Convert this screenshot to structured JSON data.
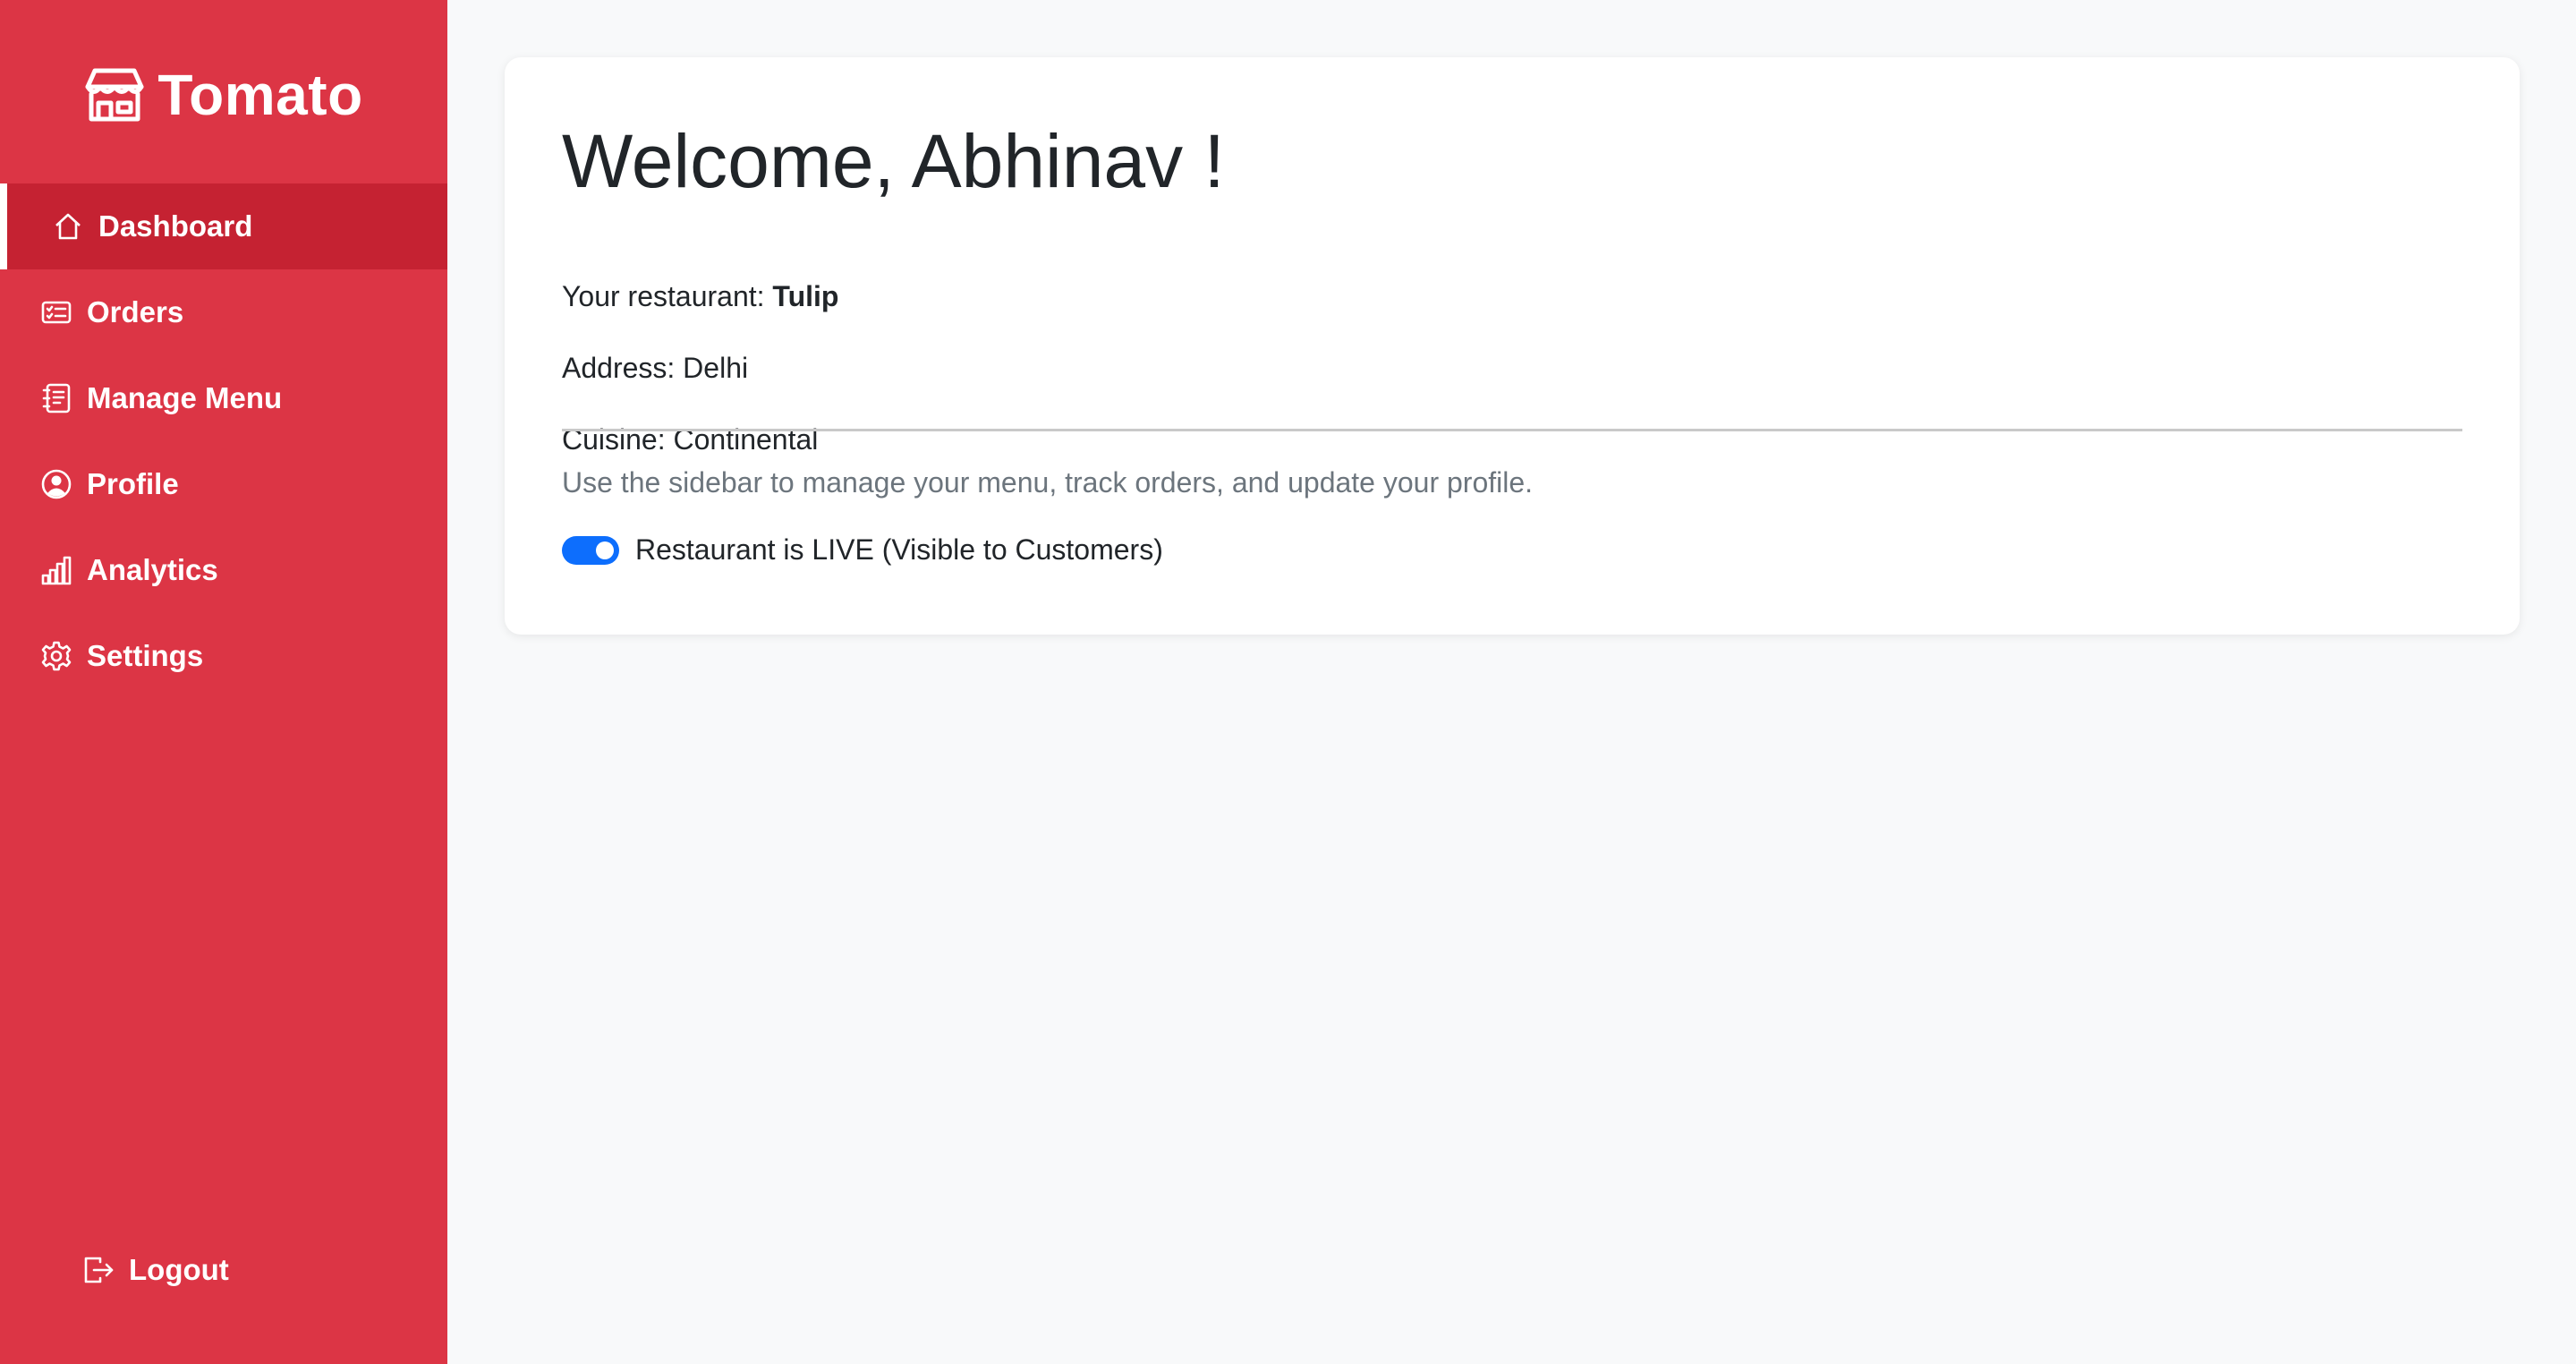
{
  "brand": {
    "name": "Tomato",
    "icon": "shop-icon"
  },
  "sidebar": {
    "items": [
      {
        "label": "Dashboard",
        "icon": "house-icon",
        "active": true
      },
      {
        "label": "Orders",
        "icon": "card-checklist-icon",
        "active": false
      },
      {
        "label": "Manage Menu",
        "icon": "journal-text-icon",
        "active": false
      },
      {
        "label": "Profile",
        "icon": "person-circle-icon",
        "active": false
      },
      {
        "label": "Analytics",
        "icon": "bar-chart-icon",
        "active": false
      },
      {
        "label": "Settings",
        "icon": "gear-icon",
        "active": false
      }
    ],
    "logout": {
      "label": "Logout",
      "icon": "box-arrow-right-icon"
    }
  },
  "main": {
    "welcome": "Welcome, Abhinav !",
    "restaurant_label": "Your restaurant: ",
    "restaurant_name": "Tulip",
    "address": "Address: Delhi",
    "cuisine": "Cuisine: Continental",
    "hint": "Use the sidebar to manage your menu, track orders, and update your profile.",
    "live_toggle": {
      "label": "Restaurant is LIVE (Visible to Customers)",
      "checked": true
    }
  },
  "colors": {
    "sidebar_bg": "#dc3545",
    "sidebar_active_bg": "#c52232",
    "page_bg": "#f8f9fa",
    "toggle_on": "#0d6efd",
    "hint_text": "#6c757d"
  }
}
